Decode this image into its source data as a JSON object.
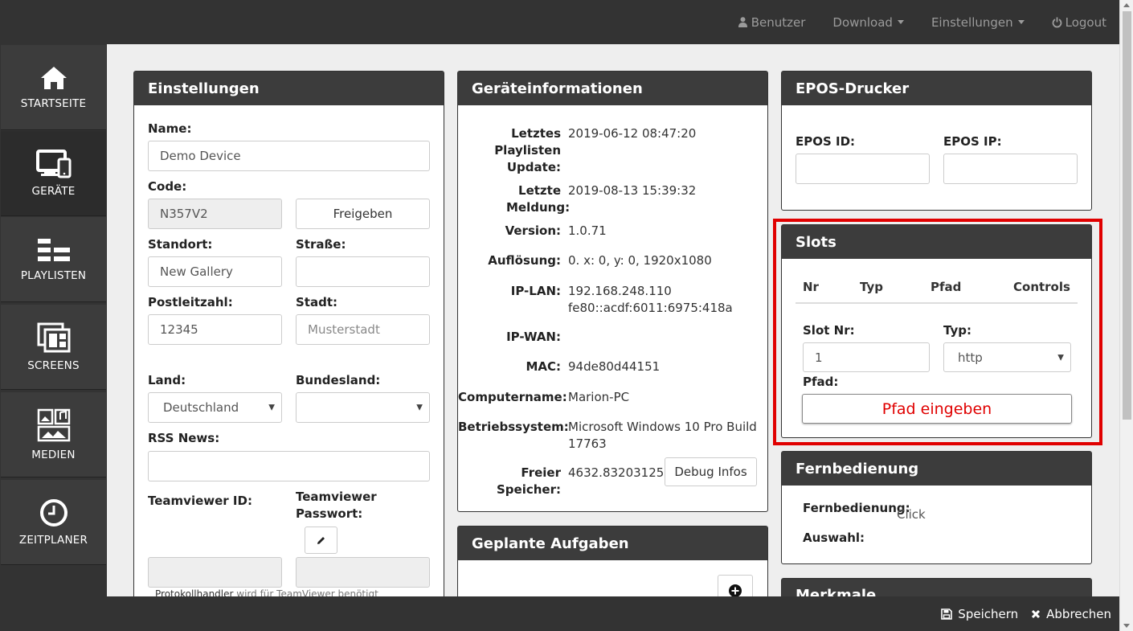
{
  "topnav": {
    "user": "Benutzer",
    "download": "Download",
    "settings": "Einstellungen",
    "logout": "Logout"
  },
  "sidebar": {
    "items": [
      {
        "label": "STARTSEITE",
        "icon": "home-icon"
      },
      {
        "label": "GERÄTE",
        "icon": "devices-icon"
      },
      {
        "label": "PLAYLISTEN",
        "icon": "playlist-icon"
      },
      {
        "label": "SCREENS",
        "icon": "screens-icon"
      },
      {
        "label": "MEDIEN",
        "icon": "media-icon"
      },
      {
        "label": "ZEITPLANER",
        "icon": "clock-icon"
      }
    ]
  },
  "settings_panel": {
    "title": "Einstellungen",
    "name_label": "Name:",
    "name_value": "Demo Device",
    "code_label": "Code:",
    "code_value": "N357V2",
    "release_button": "Freigeben",
    "location_label": "Standort:",
    "location_value": "New Gallery",
    "street_label": "Straße:",
    "street_value": "",
    "zip_label": "Postleitzahl:",
    "zip_value": "12345",
    "city_label": "Stadt:",
    "city_placeholder": "Musterstadt",
    "country_label": "Land:",
    "country_value": "Deutschland",
    "state_label": "Bundesland:",
    "state_value": "",
    "rss_label": "RSS News:",
    "rss_value": "",
    "teamviewer_id_label": "Teamviewer ID:",
    "teamviewer_pw_label": "Teamviewer Passwort:",
    "protocol_note_link": "Protokollhandler",
    "protocol_note_text": "wird für TeamViewer benötigt"
  },
  "device_info": {
    "title": "Geräteinformationen",
    "rows": [
      {
        "key": "Letztes Playlisten Update:",
        "value": "2019-06-12 08:47:20"
      },
      {
        "key": "Letzte Meldung:",
        "value": "2019-08-13 15:39:32"
      },
      {
        "key": "Version:",
        "value": "1.0.71"
      },
      {
        "key": "Auflösung:",
        "value": "0. x: 0, y: 0, 1920x1080"
      },
      {
        "key": "IP-LAN:",
        "value": "192.168.248.110 fe80::acdf:6011:6975:418a"
      },
      {
        "key": "IP-WAN:",
        "value": ""
      },
      {
        "key": "MAC:",
        "value": "94de80d44151"
      },
      {
        "key": "Computername:",
        "value": "Marion-PC"
      },
      {
        "key": "Betriebssystem:",
        "value": "Microsoft Windows 10 Pro Build 17763"
      },
      {
        "key": "Freier Speicher:",
        "value": "4632.83203125"
      }
    ],
    "debug_button": "Debug Infos"
  },
  "tasks_panel": {
    "title": "Geplante Aufgaben"
  },
  "epos_panel": {
    "title": "EPOS-Drucker",
    "id_label": "EPOS ID:",
    "ip_label": "EPOS IP:"
  },
  "slots_panel": {
    "title": "Slots",
    "columns": [
      "Nr",
      "Typ",
      "Pfad",
      "Controls"
    ],
    "slot_nr_label": "Slot Nr:",
    "slot_nr_value": "1",
    "type_label": "Typ:",
    "type_value": "http",
    "path_label": "Pfad:",
    "path_placeholder": "Pfad eingeben",
    "highlight_color": "#e00000"
  },
  "remote_panel": {
    "title": "Fernbedienung",
    "remote_label": "Fernbedienung:",
    "remote_value": "Click",
    "selection_label": "Auswahl:"
  },
  "features_panel": {
    "title": "Merkmale"
  },
  "footer": {
    "save": "Speichern",
    "cancel": "Abbrechen"
  }
}
